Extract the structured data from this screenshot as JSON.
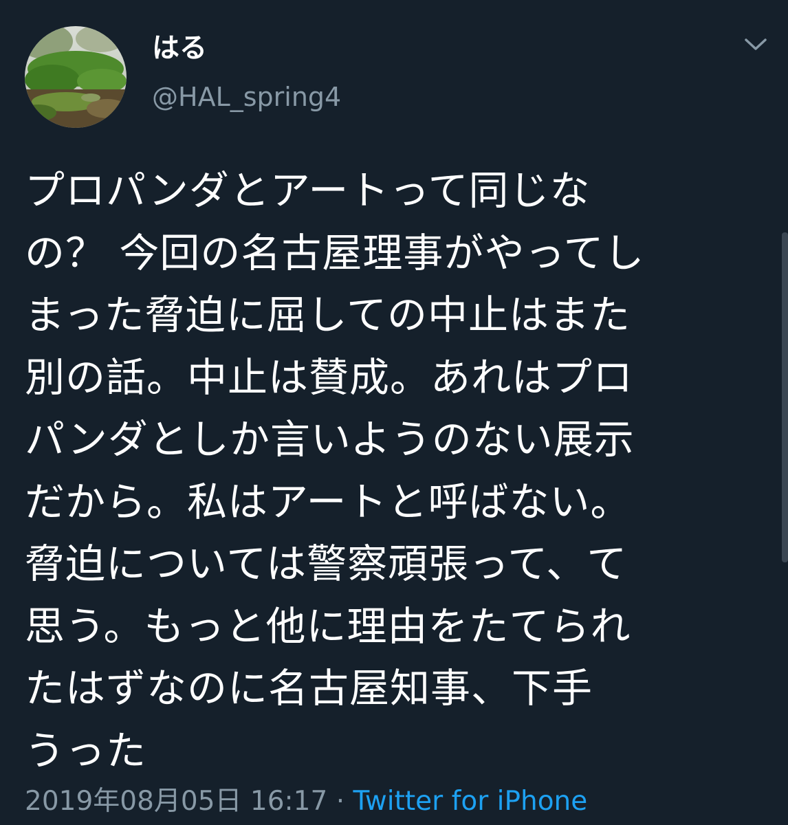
{
  "author": {
    "display_name": "はる",
    "handle": "@HAL_spring4"
  },
  "icons": {
    "menu": "chevron-down-icon",
    "avatar": "nature-photo-avatar"
  },
  "tweet": {
    "lines": [
      "プロパンダとアートって同じな",
      "の？ 今回の名古屋理事がやってし",
      "まった脅迫に屈しての中止はまた",
      "別の話。中止は賛成。あれはプロ",
      "パンダとしか言いようのない展示",
      "だから。私はアートと呼ばない。",
      "脅迫については警察頑張って、て",
      "思う。もっと他に理由をたてられ",
      "たはずなのに名古屋知事、下手",
      "うった"
    ]
  },
  "meta": {
    "timestamp": "2019年08月05日 16:17",
    "separator": " · ",
    "source": "Twitter for iPhone"
  },
  "colors": {
    "background": "#15202b",
    "text": "#ffffff",
    "secondary": "#8899a6",
    "link": "#1da1f2"
  }
}
